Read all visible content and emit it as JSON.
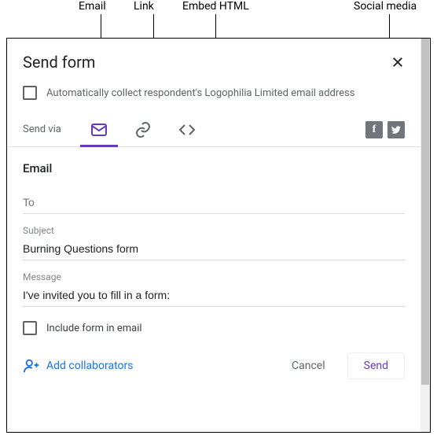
{
  "annotations": {
    "email": "Email",
    "link": "Link",
    "embed": "Embed HTML",
    "social": "Social media"
  },
  "dialog": {
    "title": "Send form",
    "auto_collect_label": "Automatically collect respondent's Logophilia Limited email address",
    "send_via_label": "Send via"
  },
  "email_section": {
    "heading": "Email",
    "to_placeholder": "To",
    "subject_label": "Subject",
    "subject_value": "Burning Questions form",
    "message_label": "Message",
    "message_value": "I've invited you to fill in a form:",
    "include_form_label": "Include form in email"
  },
  "footer": {
    "add_collaborators": "Add collaborators",
    "cancel": "Cancel",
    "send": "Send"
  },
  "icons": {
    "facebook_letter": "f",
    "twitter_letter": "t"
  }
}
